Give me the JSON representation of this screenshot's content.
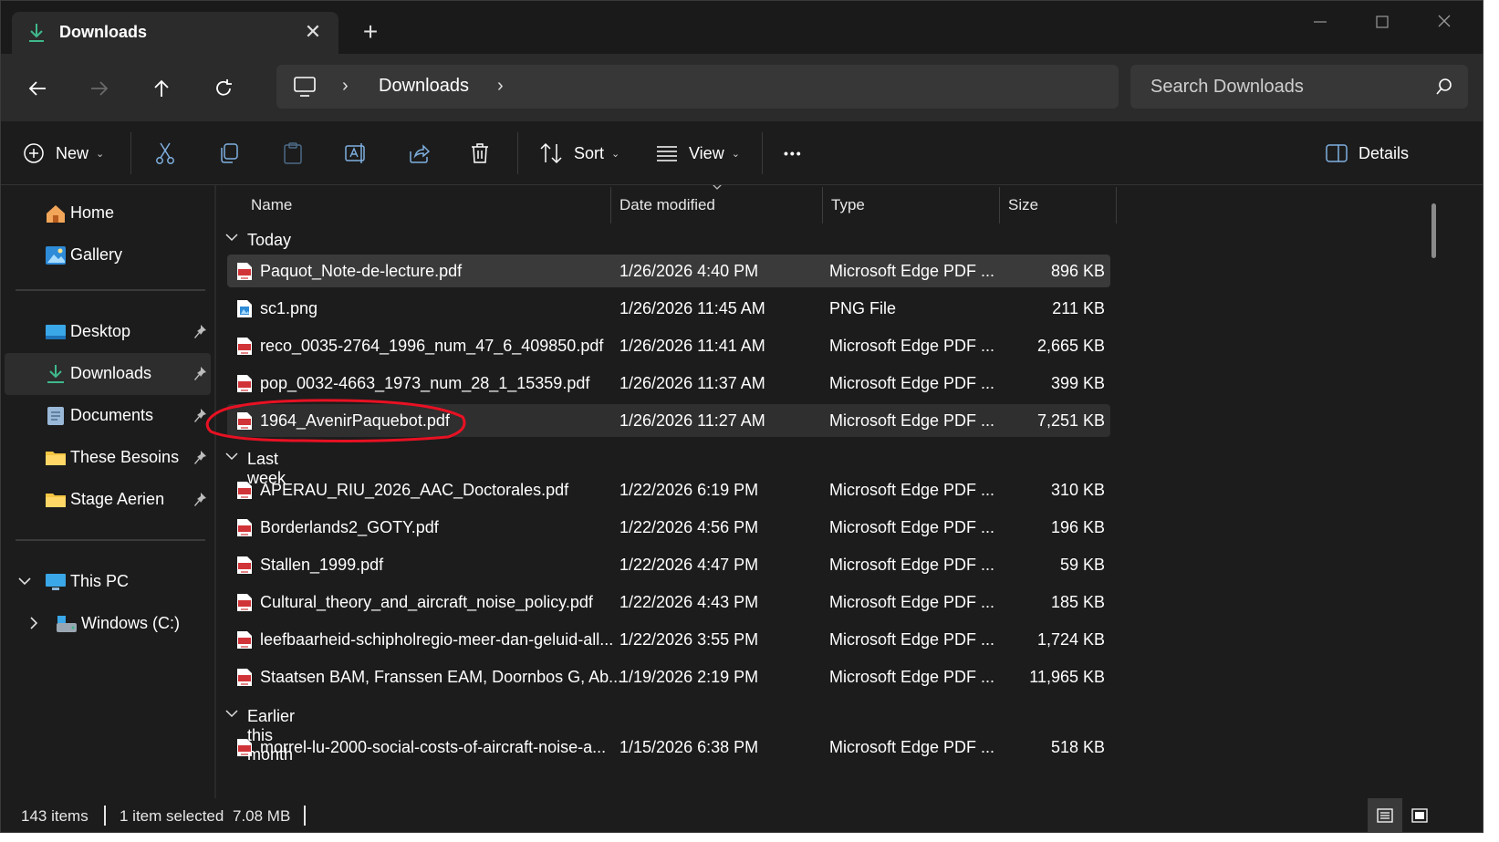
{
  "window": {
    "tab_title": "Downloads",
    "tab_close": "✕",
    "new_tab": "+"
  },
  "nav": {
    "breadcrumb": "Downloads",
    "chevron": "›",
    "search_placeholder": "Search Downloads"
  },
  "commands": {
    "new_label": "New",
    "sort_label": "Sort",
    "view_label": "View",
    "more_label": "•••",
    "details_label": "Details",
    "caret": "⌄"
  },
  "sidebar": {
    "home": "Home",
    "gallery": "Gallery",
    "desktop": "Desktop",
    "downloads": "Downloads",
    "documents": "Documents",
    "these_besoins": "These Besoins",
    "stage_aerien": "Stage Aerien",
    "this_pc": "This PC",
    "windows_c": "Windows (C:)",
    "chev_down": "⌄",
    "chev_right": "›"
  },
  "columns": {
    "name": "Name",
    "date": "Date modified",
    "type": "Type",
    "size": "Size"
  },
  "groups": {
    "today": "Today",
    "last_week": "Last week",
    "earlier": "Earlier this month"
  },
  "files": [
    {
      "name": "Paquot_Note-de-lecture.pdf",
      "date": "1/26/2026 4:40 PM",
      "type": "Microsoft Edge PDF ...",
      "size": "896 KB",
      "icon": "pdf-icon"
    },
    {
      "name": "sc1.png",
      "date": "1/26/2026 11:45 AM",
      "type": "PNG File",
      "size": "211 KB",
      "icon": "png-icon"
    },
    {
      "name": "reco_0035-2764_1996_num_47_6_409850.pdf",
      "date": "1/26/2026 11:41 AM",
      "type": "Microsoft Edge PDF ...",
      "size": "2,665 KB",
      "icon": "pdf-icon"
    },
    {
      "name": "pop_0032-4663_1973_num_28_1_15359.pdf",
      "date": "1/26/2026 11:37 AM",
      "type": "Microsoft Edge PDF ...",
      "size": "399 KB",
      "icon": "pdf-icon"
    },
    {
      "name": "1964_AvenirPaquebot.pdf",
      "date": "1/26/2026 11:27 AM",
      "type": "Microsoft Edge PDF ...",
      "size": "7,251 KB",
      "icon": "pdf-icon"
    },
    {
      "name": "APERAU_RIU_2026_AAC_Doctorales.pdf",
      "date": "1/22/2026 6:19 PM",
      "type": "Microsoft Edge PDF ...",
      "size": "310 KB",
      "icon": "pdf-icon"
    },
    {
      "name": "Borderlands2_GOTY.pdf",
      "date": "1/22/2026 4:56 PM",
      "type": "Microsoft Edge PDF ...",
      "size": "196 KB",
      "icon": "pdf-icon"
    },
    {
      "name": "Stallen_1999.pdf",
      "date": "1/22/2026 4:47 PM",
      "type": "Microsoft Edge PDF ...",
      "size": "59 KB",
      "icon": "pdf-icon"
    },
    {
      "name": "Cultural_theory_and_aircraft_noise_policy.pdf",
      "date": "1/22/2026 4:43 PM",
      "type": "Microsoft Edge PDF ...",
      "size": "185 KB",
      "icon": "pdf-icon"
    },
    {
      "name": "leefbaarheid-schipholregio-meer-dan-geluid-all...",
      "date": "1/22/2026 3:55 PM",
      "type": "Microsoft Edge PDF ...",
      "size": "1,724 KB",
      "icon": "pdf-icon"
    },
    {
      "name": "Staatsen BAM, Franssen EAM, Doornbos G, Ab...",
      "date": "1/19/2026 2:19 PM",
      "type": "Microsoft Edge PDF ...",
      "size": "11,965 KB",
      "icon": "pdf-icon"
    },
    {
      "name": "morrel-lu-2000-social-costs-of-aircraft-noise-a...",
      "date": "1/15/2026 6:38 PM",
      "type": "Microsoft Edge PDF ...",
      "size": "518 KB",
      "icon": "pdf-icon"
    }
  ],
  "status": {
    "items": "143 items",
    "selected": "1 item selected",
    "size": "7.08 MB"
  },
  "colors": {
    "background": "#1c1c1c",
    "accent_green": "#3fb98c",
    "pdf_red": "#d13438",
    "annotation_red": "#e81123"
  }
}
